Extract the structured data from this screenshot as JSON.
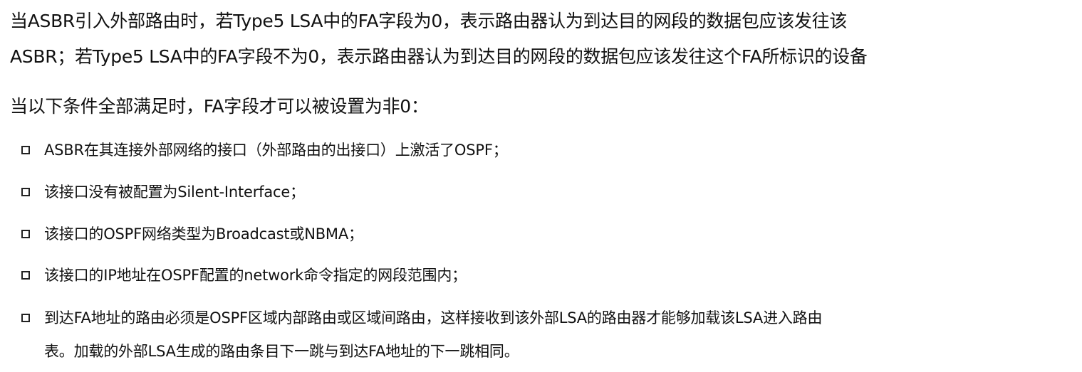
{
  "paragraphs": [
    "当ASBR引入外部路由时，若Type5  LSA中的FA字段为0，表示路由器认为到达目的网段的数据包应该发往该",
    "ASBR；若Type5  LSA中的FA字段不为0，表示路由器认为到达目的网段的数据包应该发往这个FA所标识的设备",
    "当以下条件全部满足时，FA字段才可以被设置为非0："
  ],
  "bullets": [
    "ASBR在其连接外部网络的接口（外部路由的出接口）上激活了OSPF；",
    "该接口没有被配置为Silent-Interface；",
    "该接口的OSPF网络类型为Broadcast或NBMA；",
    "该接口的IP地址在OSPF配置的network命令指定的网段范围内；",
    "到达FA地址的路由必须是OSPF区域内部路由或区域间路由，这样接收到该外部LSA的路由器才能够加载该LSA进入路由"
  ],
  "bullet_continuation": "表。加载的外部LSA生成的路由条目下一跳与到达FA地址的下一跳相同。"
}
